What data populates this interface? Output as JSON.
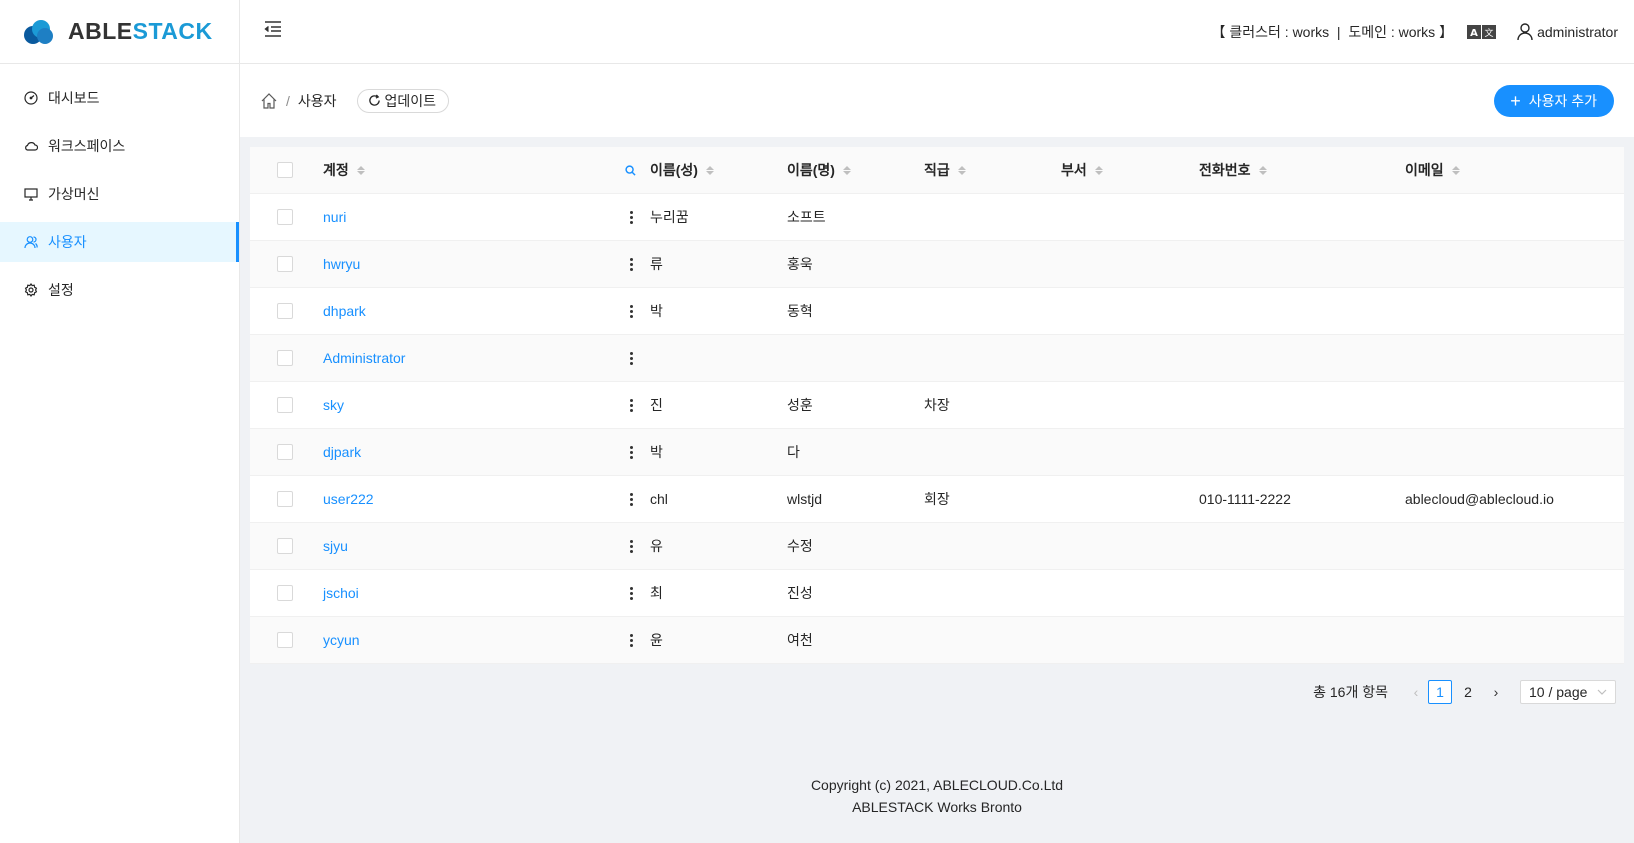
{
  "app": {
    "logo_text_dark": "ABLE",
    "logo_text_blue": "STACK",
    "brand_blue": "#1b9ad6",
    "accent": "#1890ff"
  },
  "sidebar": {
    "items": [
      {
        "label": "대시보드",
        "icon": "dashboard-icon"
      },
      {
        "label": "워크스페이스",
        "icon": "cloud-icon"
      },
      {
        "label": "가상머신",
        "icon": "desktop-icon"
      },
      {
        "label": "사용자",
        "icon": "user-icon",
        "active": true
      },
      {
        "label": "설정",
        "icon": "gear-icon"
      }
    ]
  },
  "header": {
    "cluster_info": "【 클러스터 : works  |  도메인 : works 】",
    "username": "administrator"
  },
  "page": {
    "breadcrumb_current": "사용자",
    "refresh_label": "업데이트",
    "add_user_label": "사용자 추가"
  },
  "table": {
    "columns": [
      "계정",
      "이름(성)",
      "이름(명)",
      "직급",
      "부서",
      "전화번호",
      "이메일"
    ],
    "rows": [
      {
        "account": "nuri",
        "last": "누리꿈",
        "first": "소프트",
        "rank": "",
        "dept": "",
        "phone": "",
        "email": ""
      },
      {
        "account": "hwryu",
        "last": "류",
        "first": "홍욱",
        "rank": "",
        "dept": "",
        "phone": "",
        "email": ""
      },
      {
        "account": "dhpark",
        "last": "박",
        "first": "동혁",
        "rank": "",
        "dept": "",
        "phone": "",
        "email": ""
      },
      {
        "account": "Administrator",
        "last": "",
        "first": "",
        "rank": "",
        "dept": "",
        "phone": "",
        "email": ""
      },
      {
        "account": "sky",
        "last": "진",
        "first": "성훈",
        "rank": "차장",
        "dept": "",
        "phone": "",
        "email": ""
      },
      {
        "account": "djpark",
        "last": "박",
        "first": "다",
        "rank": "",
        "dept": "",
        "phone": "",
        "email": ""
      },
      {
        "account": "user222",
        "last": "chl",
        "first": "wlstjd",
        "rank": "회장",
        "dept": "",
        "phone": "010-1111-2222",
        "email": "ablecloud@ablecloud.io"
      },
      {
        "account": "sjyu",
        "last": "유",
        "first": "수정",
        "rank": "",
        "dept": "",
        "phone": "",
        "email": ""
      },
      {
        "account": "jschoi",
        "last": "최",
        "first": "진성",
        "rank": "",
        "dept": "",
        "phone": "",
        "email": ""
      },
      {
        "account": "ycyun",
        "last": "윤",
        "first": "여천",
        "rank": "",
        "dept": "",
        "phone": "",
        "email": ""
      }
    ]
  },
  "pagination": {
    "total_text": "총 16개 항목",
    "pages": [
      "1",
      "2"
    ],
    "current": "1",
    "page_size": "10 / page"
  },
  "footer": {
    "line1": "Copyright (c) 2021, ABLECLOUD.Co.Ltd",
    "line2": "ABLESTACK Works Bronto"
  }
}
